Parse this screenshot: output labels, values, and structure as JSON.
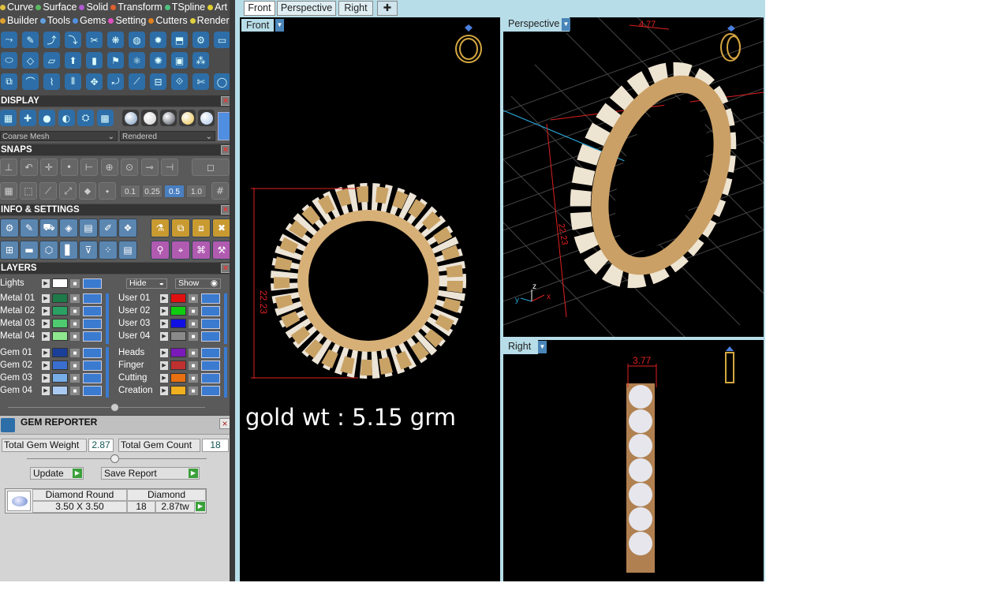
{
  "menu_row1": [
    {
      "label": "Curve",
      "color": "#e0c040"
    },
    {
      "label": "Surface",
      "color": "#5ab860"
    },
    {
      "label": "Solid",
      "color": "#b05ad0"
    },
    {
      "label": "Transform",
      "color": "#e06030"
    },
    {
      "label": "TSpline",
      "color": "#50c080"
    },
    {
      "label": "Art",
      "color": "#e0d030"
    }
  ],
  "menu_row2": [
    {
      "label": "Builder",
      "color": "#e0a030"
    },
    {
      "label": "Tools",
      "color": "#60a0e0"
    },
    {
      "label": "Gems",
      "color": "#5090e0"
    },
    {
      "label": "Setting",
      "color": "#e050c0"
    },
    {
      "label": "Cutters",
      "color": "#e08020"
    },
    {
      "label": "Render",
      "color": "#e0d040"
    }
  ],
  "display": {
    "title": "DISPLAY",
    "mesh_dropdown": "Coarse Mesh",
    "render_dropdown": "Rendered"
  },
  "snaps": {
    "title": "SNAPS",
    "values": [
      "0.1",
      "0.25",
      "0.5",
      "1.0"
    ]
  },
  "info": {
    "title": "INFO & SETTINGS"
  },
  "layers": {
    "title": "LAYERS",
    "lights_label": "Lights",
    "hide_label": "Hide",
    "show_label": "Show",
    "left": [
      {
        "name": "Metal 01",
        "color": "#1f7a4a"
      },
      {
        "name": "Metal 02",
        "color": "#2aa062"
      },
      {
        "name": "Metal 03",
        "color": "#4ecb6e"
      },
      {
        "name": "Metal 04",
        "color": "#8ee88e"
      },
      {
        "name": "Gem 01",
        "color": "#1a3f99"
      },
      {
        "name": "Gem 02",
        "color": "#3a6fd0"
      },
      {
        "name": "Gem 03",
        "color": "#77aee8"
      },
      {
        "name": "Gem 04",
        "color": "#a9c9f0"
      }
    ],
    "right": [
      {
        "name": "User 01",
        "color": "#e01010"
      },
      {
        "name": "User 02",
        "color": "#10cc10"
      },
      {
        "name": "User 03",
        "color": "#1010e0"
      },
      {
        "name": "User 04",
        "color": "#8a8a8a"
      },
      {
        "name": "Heads",
        "color": "#7a1ab8"
      },
      {
        "name": "Finger",
        "color": "#c03030"
      },
      {
        "name": "Cutting",
        "color": "#e87010"
      },
      {
        "name": "Creation",
        "color": "#f0b020"
      }
    ]
  },
  "gem_reporter": {
    "title": "GEM REPORTER",
    "weight_label": "Total Gem Weight",
    "weight_value": "2.87",
    "count_label": "Total Gem Count",
    "count_value": "18",
    "update_label": "Update",
    "save_label": "Save Report",
    "cut_header": "Diamond Round",
    "type_header": "Diamond",
    "size": "3.50 X 3.50",
    "count": "18",
    "weight": "2.87tw"
  },
  "tabs": [
    "Front",
    "Perspective",
    "Right"
  ],
  "viewports": {
    "front_label": "Front",
    "perspective_label": "Perspective",
    "right_label": "Right",
    "front_dim": "22.23",
    "persp_dim_top": "4.77",
    "persp_dim_side": "22.23",
    "right_dim": "3.77",
    "axis_z": "z",
    "axis_y": "y",
    "axis_x": "x",
    "annotation": "gold wt : 5.15 grm"
  }
}
